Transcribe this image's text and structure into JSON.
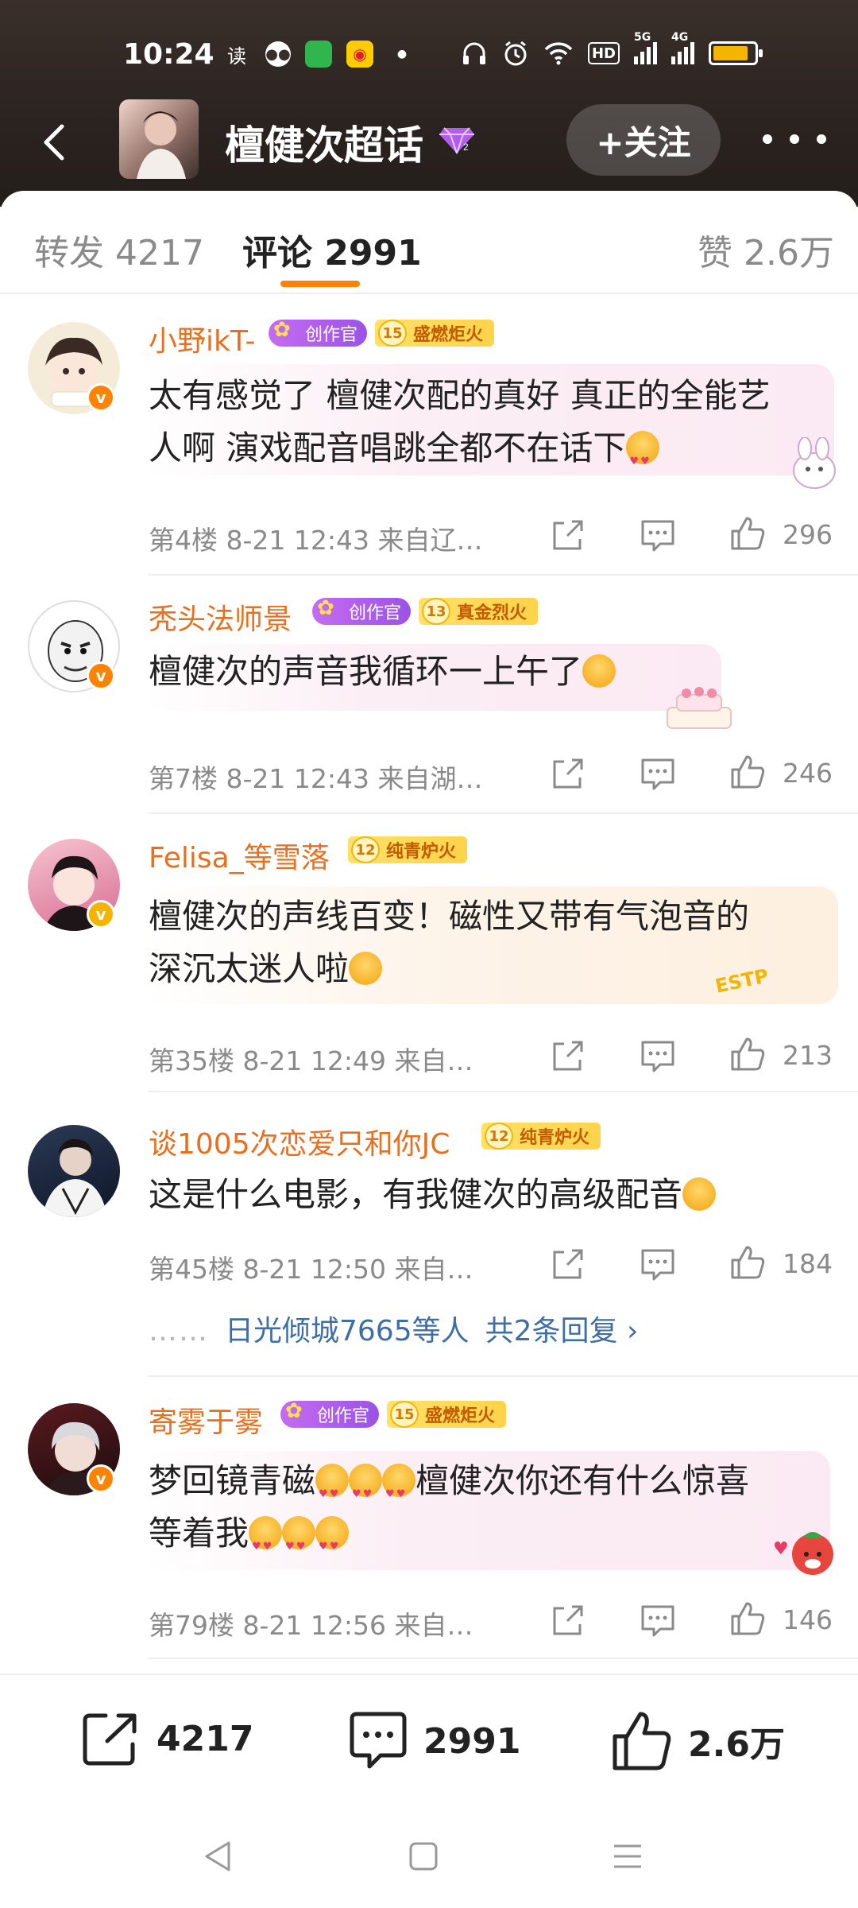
{
  "status_bar": {
    "time": "10:24",
    "read_label": "读",
    "hd": "HD",
    "net1": "5G",
    "net2": "4G"
  },
  "header": {
    "title": "檀健次超话",
    "follow_label": "+关注"
  },
  "tabs": [
    {
      "label": "转发 4217"
    },
    {
      "label": "评论 2991"
    },
    {
      "label": "赞 2.6万"
    }
  ],
  "comments": [
    {
      "username": "小野ikT-",
      "creator_badge": "创作官",
      "fire_level": "15",
      "fire_label": "盛燃炬火",
      "text_line1": "太有感觉了 檀健次配的真好 真正的全能艺",
      "text_line2": "人啊 演戏配音唱跳全都不在话下",
      "meta": "第4楼  8-21 12:43  来自辽…",
      "likes": "296"
    },
    {
      "username": "秃头法师景",
      "creator_badge": "创作官",
      "fire_level": "13",
      "fire_label": "真金烈火",
      "text_line1": "檀健次的声音我循环一上午了",
      "meta": "第7楼  8-21 12:43  来自湖…",
      "likes": "246"
    },
    {
      "username": "Felisa_等雪落",
      "fire_level": "12",
      "fire_label": "纯青炉火",
      "text_line1": "檀健次的声线百变！磁性又带有气泡音的",
      "text_line2": "深沉太迷人啦",
      "decoration": "ESTP",
      "meta": "第35楼  8-21 12:49  来自…",
      "likes": "213"
    },
    {
      "username": "谈1005次恋爱只和你JC",
      "fire_level": "12",
      "fire_label": "纯青炉火",
      "text_line1": "这是什么电影，有我健次的高级配音",
      "meta": "第45楼  8-21 12:50  来自…",
      "likes": "184",
      "reply_dots": "……",
      "reply_names": "日光倾城7665等人",
      "reply_count": "共2条回复 ›"
    },
    {
      "username": "寄雾于雾",
      "creator_badge": "创作官",
      "fire_level": "15",
      "fire_label": "盛燃炬火",
      "text_line1": "梦回镜青磁",
      "text_line1b": "檀健次你还有什么惊喜",
      "text_line2": "等着我",
      "meta": "第79楼  8-21 12:56  来自…",
      "likes": "146"
    }
  ],
  "bottom_bar": {
    "reposts": "4217",
    "comments": "2991",
    "likes": "2.6万"
  },
  "colors": {
    "accent": "#ff8200",
    "username": "#e86f1d",
    "link": "#3e6ea5"
  }
}
